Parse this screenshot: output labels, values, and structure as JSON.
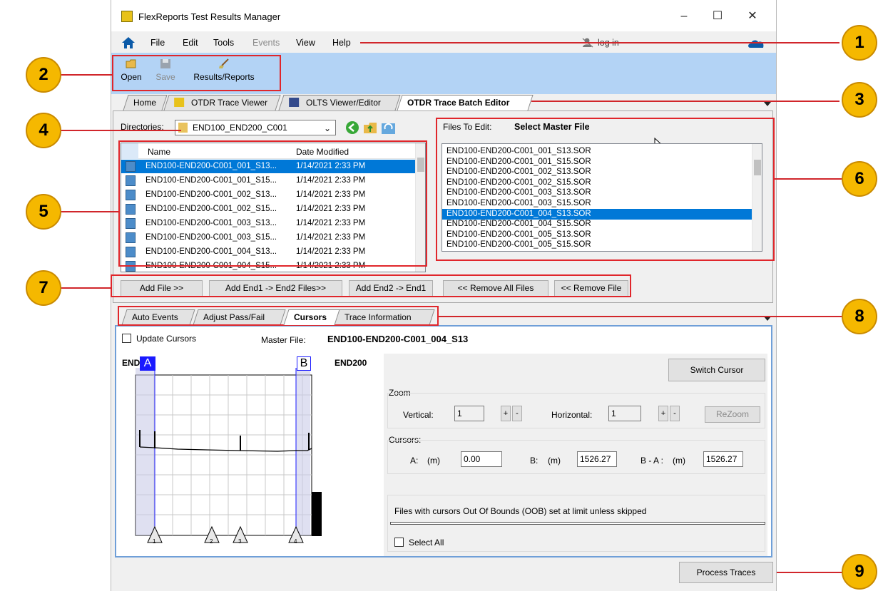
{
  "app": {
    "title": "FlexReports Test Results Manager",
    "minimize": "–",
    "maximize": "☐",
    "close": "✕"
  },
  "menu": {
    "items": [
      "File",
      "Edit",
      "Tools",
      "Events",
      "View",
      "Help"
    ],
    "login": "log in"
  },
  "toolbar": {
    "open": "Open",
    "save": "Save",
    "results": "Results/Reports"
  },
  "tabs": [
    "Home",
    "OTDR Trace Viewer",
    "OLTS Viewer/Editor",
    "OTDR Trace Batch Editor"
  ],
  "directories": {
    "label": "Directories:",
    "value": "END100_END200_C001"
  },
  "file_list": {
    "headers": [
      "Name",
      "Date Modified"
    ],
    "rows": [
      {
        "name": "END100-END200-C001_001_S13...",
        "date": "1/14/2021 2:33 PM"
      },
      {
        "name": "END100-END200-C001_001_S15...",
        "date": "1/14/2021 2:33 PM"
      },
      {
        "name": "END100-END200-C001_002_S13...",
        "date": "1/14/2021 2:33 PM"
      },
      {
        "name": "END100-END200-C001_002_S15...",
        "date": "1/14/2021 2:33 PM"
      },
      {
        "name": "END100-END200-C001_003_S13...",
        "date": "1/14/2021 2:33 PM"
      },
      {
        "name": "END100-END200-C001_003_S15...",
        "date": "1/14/2021 2:33 PM"
      },
      {
        "name": "END100-END200-C001_004_S13...",
        "date": "1/14/2021 2:33 PM"
      },
      {
        "name": "END100-END200-C001_004_S15...",
        "date": "1/14/2021 2:33 PM"
      }
    ]
  },
  "files_to_edit": {
    "label": "Files To Edit:",
    "heading": "Select Master File",
    "items": [
      "END100-END200-C001_001_S13.SOR",
      "END100-END200-C001_001_S15.SOR",
      "END100-END200-C001_002_S13.SOR",
      "END100-END200-C001_002_S15.SOR",
      "END100-END200-C001_003_S13.SOR",
      "END100-END200-C001_003_S15.SOR",
      "END100-END200-C001_004_S13.SOR",
      "END100-END200-C001_004_S15.SOR",
      "END100-END200-C001_005_S13.SOR",
      "END100-END200-C001_005_S15.SOR"
    ]
  },
  "actions": {
    "add_file": "Add File >>",
    "add_end1": "Add End1 -> End2 Files>>",
    "add_end2": "Add End2 -> End1",
    "remove_all": "<< Remove All Files",
    "remove_file": "<< Remove File"
  },
  "lower_tabs": [
    "Auto Events",
    "Adjust Pass/Fail",
    "Cursors",
    "Trace Information"
  ],
  "cursors": {
    "update_cursors": "Update Cursors",
    "master_label": "Master File:",
    "master_value": "END100-END200-C001_004_S13",
    "left_end": "END100",
    "right_end": "END200",
    "cursor_a": "A",
    "cursor_b": "B",
    "switch": "Switch Cursor",
    "zoom_label": "Zoom",
    "vertical_label": "Vertical:",
    "vertical_value": "1",
    "horizontal_label": "Horizontal:",
    "horizontal_value": "1",
    "plus": "+",
    "minus": "-",
    "rezoom": "ReZoom",
    "cursors_label": "Cursors:",
    "a_label": "A:",
    "b_label": "B:",
    "ba_label": "B - A :",
    "unit": "(m)",
    "a_value": "0.00",
    "b_value": "1526.27",
    "ba_value": "1526.27",
    "oob_text": "Files with cursors Out Of Bounds (OOB) set at limit unless skipped",
    "select_all": "Select All",
    "events": [
      "1",
      "2",
      "3",
      "4"
    ]
  },
  "process": "Process Traces",
  "callouts": [
    "1",
    "2",
    "3",
    "4",
    "5",
    "6",
    "7",
    "8",
    "9"
  ],
  "colors": {
    "selection": "#0078d7",
    "toolbar": "#b3d3f5",
    "callout": "#f5b800",
    "highlight": "#e0262b",
    "cursor_line": "#0000ff"
  }
}
